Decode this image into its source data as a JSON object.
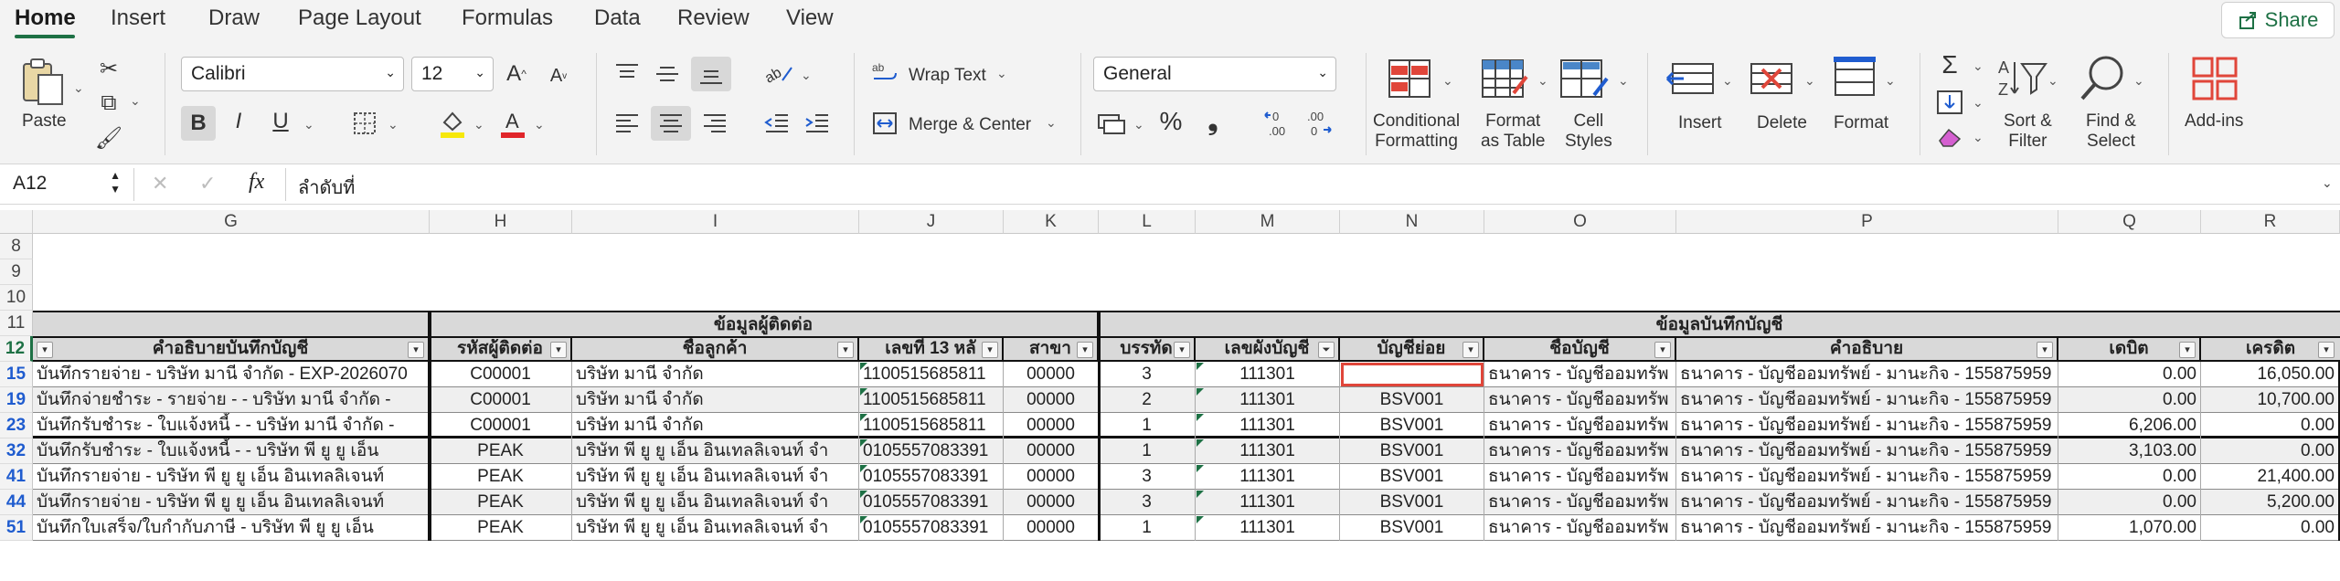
{
  "ribbon_tabs": [
    "Home",
    "Insert",
    "Draw",
    "Page Layout",
    "Formulas",
    "Data",
    "Review",
    "View"
  ],
  "share_label": "Share",
  "font": {
    "name": "Calibri",
    "size": "12"
  },
  "number_format": "General",
  "labels": {
    "paste": "Paste",
    "wrap_text": "Wrap Text",
    "merge_center": "Merge & Center",
    "conditional_formatting": "Conditional\nFormatting",
    "format_as_table": "Format\nas Table",
    "cell_styles": "Cell\nStyles",
    "insert": "Insert",
    "delete": "Delete",
    "format": "Format",
    "sort_filter": "Sort &\nFilter",
    "find_select": "Find &\nSelect",
    "add_ins": "Add-ins",
    "percent": "%",
    "comma": "❟",
    "inc_dec": ".00\n→.0",
    "dec_dec": ".00\n→.0"
  },
  "icons": {
    "bold": "B",
    "italic": "I",
    "underline": "U",
    "fx": "fx",
    "cancel": "✕",
    "enter": "✓"
  },
  "formula_bar": {
    "name_box": "A12",
    "formula": "ลำดับที่"
  },
  "columns": [
    "G",
    "H",
    "I",
    "J",
    "K",
    "L",
    "M",
    "N",
    "O",
    "P",
    "Q",
    "R"
  ],
  "row_numbers": {
    "r8": "8",
    "r9": "9",
    "r10": "10",
    "r11": "11",
    "r12": "12"
  },
  "group_headers": {
    "contact": "ข้อมูลผู้ติดต่อ",
    "record": "ข้อมูลบันทึกบัญชี"
  },
  "headers": {
    "G": "คำอธิบายบันทึกบัญชี",
    "H": "รหัสผู้ติดต่อ",
    "I": "ชื่อลูกค้า",
    "J": "เลขที่ 13 หลั",
    "K": "สาขา",
    "L": "บรรทัด",
    "M": "เลขผังบัญชี",
    "N": "บัญชีย่อย",
    "O": "ชื่อบัญชี",
    "P": "คำอธิบาย",
    "Q": "เดบิต",
    "R": "เครดิต"
  },
  "colors": {
    "accent": "#1e7145",
    "header_fill": "#d9d9d9",
    "filter_row_number": "#1f5ccf",
    "active_cell": "#e0463a"
  },
  "rows": [
    {
      "rn": "15",
      "G": "บันทึกรายจ่าย - บริษัท มานี จำกัด - EXP-2026070",
      "H": "C00001",
      "I": "บริษัท มานี จำกัด",
      "J": "1100515685811",
      "K": "00000",
      "L": "3",
      "M": "111301",
      "N": "",
      "O": "ธนาคาร - บัญชีออมทรัพ",
      "P": "ธนาคาร - บัญชีออมทรัพย์ - มานะกิจ - 155875959",
      "Q": "0.00",
      "R": "16,050.00"
    },
    {
      "rn": "19",
      "G": "บันทึกจ่ายชำระ - รายจ่าย - - บริษัท มานี จำกัด -",
      "H": "C00001",
      "I": "บริษัท มานี จำกัด",
      "J": "1100515685811",
      "K": "00000",
      "L": "2",
      "M": "111301",
      "N": "BSV001",
      "O": "ธนาคาร - บัญชีออมทรัพ",
      "P": "ธนาคาร - บัญชีออมทรัพย์ - มานะกิจ - 155875959",
      "Q": "0.00",
      "R": "10,700.00"
    },
    {
      "rn": "23",
      "G": "บันทึกรับชำระ - ใบแจ้งหนี้ - - บริษัท มานี จำกัด -",
      "H": "C00001",
      "I": "บริษัท มานี จำกัด",
      "J": "1100515685811",
      "K": "00000",
      "L": "1",
      "M": "111301",
      "N": "BSV001",
      "O": "ธนาคาร - บัญชีออมทรัพ",
      "P": "ธนาคาร - บัญชีออมทรัพย์ - มานะกิจ - 155875959",
      "Q": "6,206.00",
      "R": "0.00"
    },
    {
      "rn": "32",
      "G": "บันทึกรับชำระ - ใบแจ้งหนี้ - - บริษัท พี ยู ยู เอ็น",
      "H": "PEAK",
      "I": "บริษัท พี ยู ยู เอ็น อินเทลลิเจนท์ จำ",
      "J": "0105557083391",
      "K": "00000",
      "L": "1",
      "M": "111301",
      "N": "BSV001",
      "O": "ธนาคาร - บัญชีออมทรัพ",
      "P": "ธนาคาร - บัญชีออมทรัพย์ - มานะกิจ - 155875959",
      "Q": "3,103.00",
      "R": "0.00"
    },
    {
      "rn": "41",
      "G": "บันทึกรายจ่าย - บริษัท พี ยู ยู เอ็น อินเทลลิเจนท์",
      "H": "PEAK",
      "I": "บริษัท พี ยู ยู เอ็น อินเทลลิเจนท์ จำ",
      "J": "0105557083391",
      "K": "00000",
      "L": "3",
      "M": "111301",
      "N": "BSV001",
      "O": "ธนาคาร - บัญชีออมทรัพ",
      "P": "ธนาคาร - บัญชีออมทรัพย์ - มานะกิจ - 155875959",
      "Q": "0.00",
      "R": "21,400.00"
    },
    {
      "rn": "44",
      "G": "บันทึกรายจ่าย - บริษัท พี ยู ยู เอ็น อินเทลลิเจนท์",
      "H": "PEAK",
      "I": "บริษัท พี ยู ยู เอ็น อินเทลลิเจนท์ จำ",
      "J": "0105557083391",
      "K": "00000",
      "L": "3",
      "M": "111301",
      "N": "BSV001",
      "O": "ธนาคาร - บัญชีออมทรัพ",
      "P": "ธนาคาร - บัญชีออมทรัพย์ - มานะกิจ - 155875959",
      "Q": "0.00",
      "R": "5,200.00"
    },
    {
      "rn": "51",
      "G": "บันทึกใบเสร็จ/ใบกำกับภาษี - บริษัท พี ยู ยู เอ็น",
      "H": "PEAK",
      "I": "บริษัท พี ยู ยู เอ็น อินเทลลิเจนท์ จำ",
      "J": "0105557083391",
      "K": "00000",
      "L": "1",
      "M": "111301",
      "N": "BSV001",
      "O": "ธนาคาร - บัญชีออมทรัพ",
      "P": "ธนาคาร - บัญชีออมทรัพย์ - มานะกิจ - 155875959",
      "Q": "1,070.00",
      "R": "0.00"
    }
  ]
}
